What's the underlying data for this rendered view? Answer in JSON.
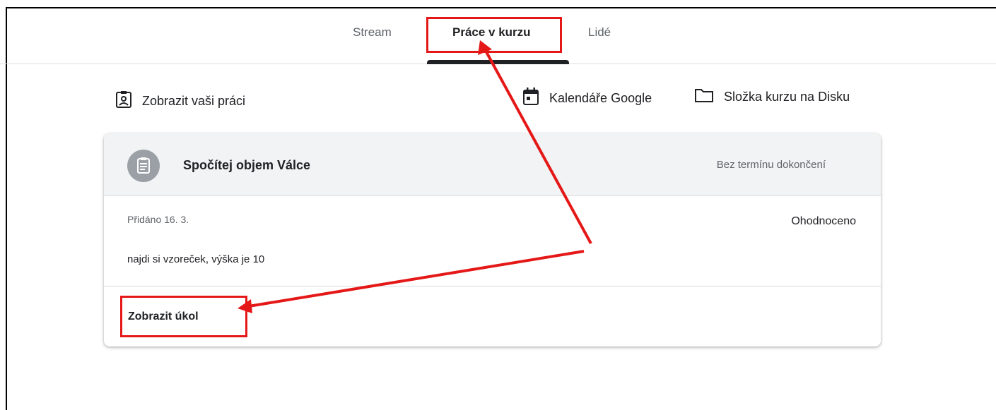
{
  "tabs": [
    {
      "label": "Stream"
    },
    {
      "label": "Práce v kurzu"
    },
    {
      "label": "Lidé"
    }
  ],
  "toolbar": {
    "view_work": "Zobrazit vaši práci",
    "calendar": "Kalendáře Google",
    "drive_folder": "Složka kurzu na Disku"
  },
  "assignment": {
    "title": "Spočítej objem Válce",
    "due": "Bez termínu dokončení",
    "added": "Přidáno 16. 3.",
    "status": "Ohodnoceno",
    "description": "najdi si vzoreček, výška je 10",
    "view_link": "Zobrazit úkol"
  },
  "annotation": {
    "color": "#e51818"
  }
}
